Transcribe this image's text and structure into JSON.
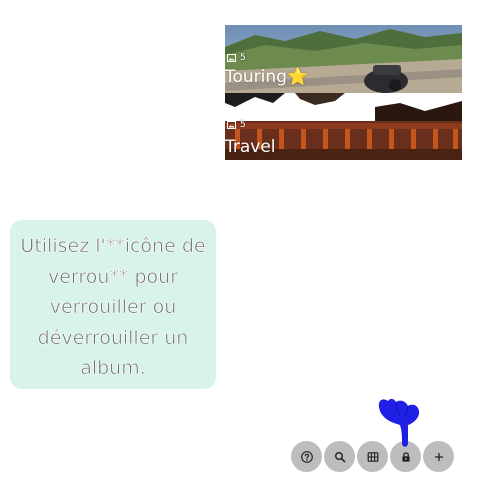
{
  "albums": [
    {
      "name": "Touring⭐",
      "count": "5",
      "count_icon": "photo-library-icon"
    },
    {
      "name": "Travel",
      "count": "5",
      "count_icon": "photo-library-icon"
    }
  ],
  "hint": {
    "text": "Utilisez l'**icône de verrou** pour verrouiller ou déverrouiller un album."
  },
  "actions": [
    {
      "id": "help",
      "icon": "help-icon"
    },
    {
      "id": "search",
      "icon": "search-icon"
    },
    {
      "id": "grid",
      "icon": "grid-view-icon"
    },
    {
      "id": "lock",
      "icon": "lock-icon"
    },
    {
      "id": "add",
      "icon": "plus-icon"
    }
  ],
  "pointer": {
    "icon": "pointing-hand-icon",
    "color": "#1f1fe6"
  },
  "colors": {
    "hint_background": "#d8f3ec",
    "hint_text": "#6e6e6e",
    "button_background": "#bdbdbd",
    "button_icon": "#222222"
  }
}
